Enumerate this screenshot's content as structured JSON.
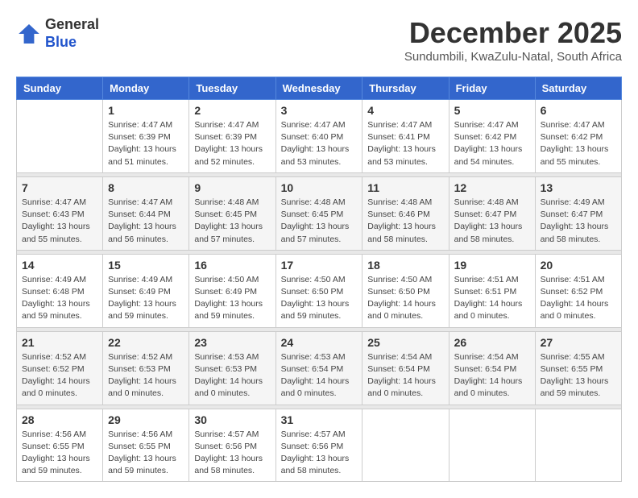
{
  "logo": {
    "general": "General",
    "blue": "Blue"
  },
  "header": {
    "month_year": "December 2025",
    "location": "Sundumbili, KwaZulu-Natal, South Africa"
  },
  "days_of_week": [
    "Sunday",
    "Monday",
    "Tuesday",
    "Wednesday",
    "Thursday",
    "Friday",
    "Saturday"
  ],
  "weeks": [
    {
      "days": [
        {
          "num": "",
          "sunrise": "",
          "sunset": "",
          "daylight": ""
        },
        {
          "num": "1",
          "sunrise": "Sunrise: 4:47 AM",
          "sunset": "Sunset: 6:39 PM",
          "daylight": "Daylight: 13 hours and 51 minutes."
        },
        {
          "num": "2",
          "sunrise": "Sunrise: 4:47 AM",
          "sunset": "Sunset: 6:39 PM",
          "daylight": "Daylight: 13 hours and 52 minutes."
        },
        {
          "num": "3",
          "sunrise": "Sunrise: 4:47 AM",
          "sunset": "Sunset: 6:40 PM",
          "daylight": "Daylight: 13 hours and 53 minutes."
        },
        {
          "num": "4",
          "sunrise": "Sunrise: 4:47 AM",
          "sunset": "Sunset: 6:41 PM",
          "daylight": "Daylight: 13 hours and 53 minutes."
        },
        {
          "num": "5",
          "sunrise": "Sunrise: 4:47 AM",
          "sunset": "Sunset: 6:42 PM",
          "daylight": "Daylight: 13 hours and 54 minutes."
        },
        {
          "num": "6",
          "sunrise": "Sunrise: 4:47 AM",
          "sunset": "Sunset: 6:42 PM",
          "daylight": "Daylight: 13 hours and 55 minutes."
        }
      ]
    },
    {
      "days": [
        {
          "num": "7",
          "sunrise": "Sunrise: 4:47 AM",
          "sunset": "Sunset: 6:43 PM",
          "daylight": "Daylight: 13 hours and 55 minutes."
        },
        {
          "num": "8",
          "sunrise": "Sunrise: 4:47 AM",
          "sunset": "Sunset: 6:44 PM",
          "daylight": "Daylight: 13 hours and 56 minutes."
        },
        {
          "num": "9",
          "sunrise": "Sunrise: 4:48 AM",
          "sunset": "Sunset: 6:45 PM",
          "daylight": "Daylight: 13 hours and 57 minutes."
        },
        {
          "num": "10",
          "sunrise": "Sunrise: 4:48 AM",
          "sunset": "Sunset: 6:45 PM",
          "daylight": "Daylight: 13 hours and 57 minutes."
        },
        {
          "num": "11",
          "sunrise": "Sunrise: 4:48 AM",
          "sunset": "Sunset: 6:46 PM",
          "daylight": "Daylight: 13 hours and 58 minutes."
        },
        {
          "num": "12",
          "sunrise": "Sunrise: 4:48 AM",
          "sunset": "Sunset: 6:47 PM",
          "daylight": "Daylight: 13 hours and 58 minutes."
        },
        {
          "num": "13",
          "sunrise": "Sunrise: 4:49 AM",
          "sunset": "Sunset: 6:47 PM",
          "daylight": "Daylight: 13 hours and 58 minutes."
        }
      ]
    },
    {
      "days": [
        {
          "num": "14",
          "sunrise": "Sunrise: 4:49 AM",
          "sunset": "Sunset: 6:48 PM",
          "daylight": "Daylight: 13 hours and 59 minutes."
        },
        {
          "num": "15",
          "sunrise": "Sunrise: 4:49 AM",
          "sunset": "Sunset: 6:49 PM",
          "daylight": "Daylight: 13 hours and 59 minutes."
        },
        {
          "num": "16",
          "sunrise": "Sunrise: 4:50 AM",
          "sunset": "Sunset: 6:49 PM",
          "daylight": "Daylight: 13 hours and 59 minutes."
        },
        {
          "num": "17",
          "sunrise": "Sunrise: 4:50 AM",
          "sunset": "Sunset: 6:50 PM",
          "daylight": "Daylight: 13 hours and 59 minutes."
        },
        {
          "num": "18",
          "sunrise": "Sunrise: 4:50 AM",
          "sunset": "Sunset: 6:50 PM",
          "daylight": "Daylight: 14 hours and 0 minutes."
        },
        {
          "num": "19",
          "sunrise": "Sunrise: 4:51 AM",
          "sunset": "Sunset: 6:51 PM",
          "daylight": "Daylight: 14 hours and 0 minutes."
        },
        {
          "num": "20",
          "sunrise": "Sunrise: 4:51 AM",
          "sunset": "Sunset: 6:52 PM",
          "daylight": "Daylight: 14 hours and 0 minutes."
        }
      ]
    },
    {
      "days": [
        {
          "num": "21",
          "sunrise": "Sunrise: 4:52 AM",
          "sunset": "Sunset: 6:52 PM",
          "daylight": "Daylight: 14 hours and 0 minutes."
        },
        {
          "num": "22",
          "sunrise": "Sunrise: 4:52 AM",
          "sunset": "Sunset: 6:53 PM",
          "daylight": "Daylight: 14 hours and 0 minutes."
        },
        {
          "num": "23",
          "sunrise": "Sunrise: 4:53 AM",
          "sunset": "Sunset: 6:53 PM",
          "daylight": "Daylight: 14 hours and 0 minutes."
        },
        {
          "num": "24",
          "sunrise": "Sunrise: 4:53 AM",
          "sunset": "Sunset: 6:54 PM",
          "daylight": "Daylight: 14 hours and 0 minutes."
        },
        {
          "num": "25",
          "sunrise": "Sunrise: 4:54 AM",
          "sunset": "Sunset: 6:54 PM",
          "daylight": "Daylight: 14 hours and 0 minutes."
        },
        {
          "num": "26",
          "sunrise": "Sunrise: 4:54 AM",
          "sunset": "Sunset: 6:54 PM",
          "daylight": "Daylight: 14 hours and 0 minutes."
        },
        {
          "num": "27",
          "sunrise": "Sunrise: 4:55 AM",
          "sunset": "Sunset: 6:55 PM",
          "daylight": "Daylight: 13 hours and 59 minutes."
        }
      ]
    },
    {
      "days": [
        {
          "num": "28",
          "sunrise": "Sunrise: 4:56 AM",
          "sunset": "Sunset: 6:55 PM",
          "daylight": "Daylight: 13 hours and 59 minutes."
        },
        {
          "num": "29",
          "sunrise": "Sunrise: 4:56 AM",
          "sunset": "Sunset: 6:55 PM",
          "daylight": "Daylight: 13 hours and 59 minutes."
        },
        {
          "num": "30",
          "sunrise": "Sunrise: 4:57 AM",
          "sunset": "Sunset: 6:56 PM",
          "daylight": "Daylight: 13 hours and 58 minutes."
        },
        {
          "num": "31",
          "sunrise": "Sunrise: 4:57 AM",
          "sunset": "Sunset: 6:56 PM",
          "daylight": "Daylight: 13 hours and 58 minutes."
        },
        {
          "num": "",
          "sunrise": "",
          "sunset": "",
          "daylight": ""
        },
        {
          "num": "",
          "sunrise": "",
          "sunset": "",
          "daylight": ""
        },
        {
          "num": "",
          "sunrise": "",
          "sunset": "",
          "daylight": ""
        }
      ]
    }
  ]
}
